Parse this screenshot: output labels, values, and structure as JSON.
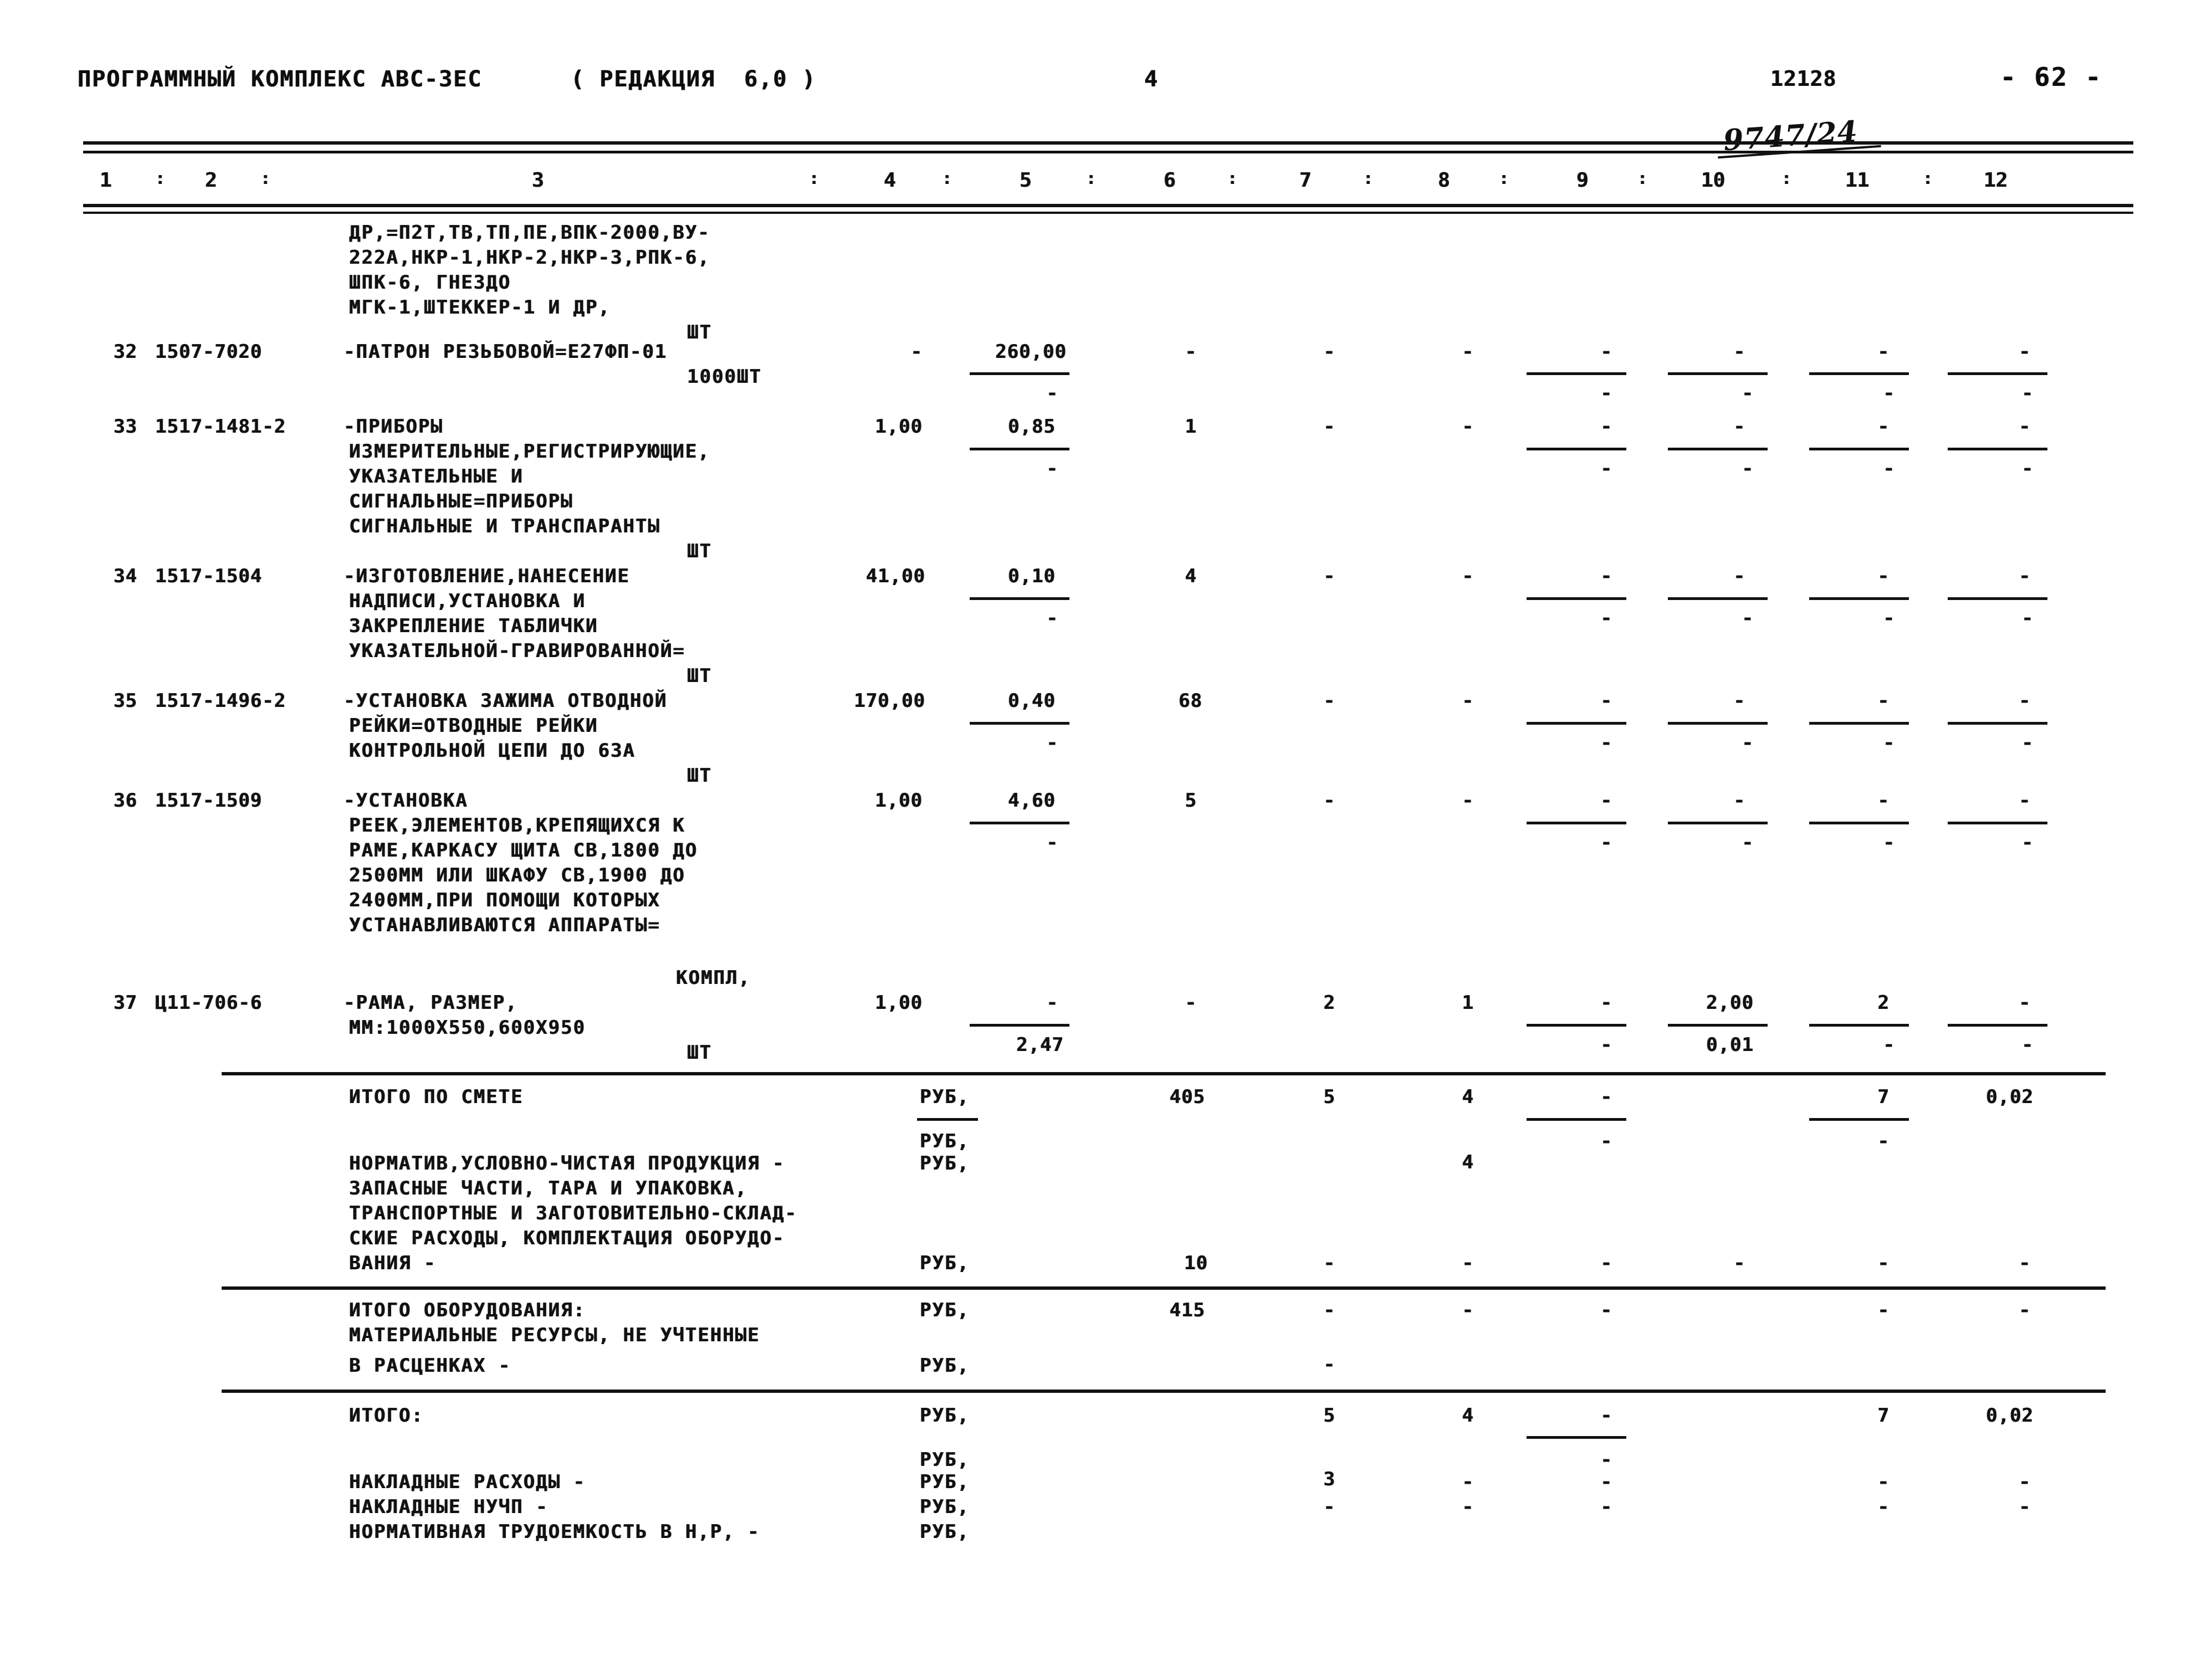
{
  "header": {
    "title": "ПРОГРАММНЫЙ КОМПЛЕКС АВС-3ЕС",
    "edition": "( РЕДАКЦИЯ  6,0 )",
    "sheet_marker": "4",
    "doc_number": "12128",
    "page_label": "- 62 -",
    "handwritten_note": "9747/24"
  },
  "table": {
    "column_headers": [
      "1",
      "2",
      "3",
      "4",
      "5",
      "6",
      "7",
      "8",
      "9",
      "10",
      "11",
      "12"
    ],
    "column_separator": ":",
    "continuation_block": {
      "description_lines": [
        "ДР,=П2Т,ТВ,ТП,ПЕ,ВПК-2000,ВУ-",
        "222А,НКР-1,НКР-2,НКР-3,РПК-6,",
        "ШПК-6, ГНЕЗДО",
        "МГК-1,ШТЕККЕР-1 И ДР,"
      ],
      "unit": "ШТ"
    },
    "rows": [
      {
        "num": "32",
        "code": "1507-7020",
        "description_lines": [
          "-ПАТРОН РЕЗЬБОВОЙ=Е27ФП-01"
        ],
        "unit_below": "1000ШТ",
        "c4": "-",
        "c5": "260,00",
        "c5b": "-",
        "c6": "-",
        "c7": "-",
        "c8": "-",
        "c9": "-",
        "c9b": "-",
        "c10": "-",
        "c10b": "-",
        "c11": "-",
        "c11b": "-",
        "c12": "-",
        "c12b": "-"
      },
      {
        "num": "33",
        "code": "1517-1481-2",
        "description_lines": [
          "-ПРИБОРЫ",
          "ИЗМЕРИТЕЛЬНЫЕ,РЕГИСТРИРУЮЩИЕ,",
          "УКАЗАТЕЛЬНЫЕ И",
          "СИГНАЛЬНЫЕ=ПРИБОРЫ",
          "СИГНАЛЬНЫЕ И ТРАНСПАРАНТЫ"
        ],
        "unit_below": "ШТ",
        "c4": "1,00",
        "c5": "0,85",
        "c5b": "-",
        "c6": "1",
        "c7": "-",
        "c8": "-",
        "c9": "-",
        "c9b": "-",
        "c10": "-",
        "c10b": "-",
        "c11": "-",
        "c11b": "-",
        "c12": "-",
        "c12b": "-"
      },
      {
        "num": "34",
        "code": "1517-1504",
        "description_lines": [
          "-ИЗГОТОВЛЕНИЕ,НАНЕСЕНИЕ",
          "НАДПИСИ,УСТАНОВКА И",
          "ЗАКРЕПЛЕНИЕ ТАБЛИЧКИ",
          "УКАЗАТЕЛЬНОЙ-ГРАВИРОВАННОЙ="
        ],
        "unit_below": "ШТ",
        "c4": "41,00",
        "c5": "0,10",
        "c5b": "-",
        "c6": "4",
        "c7": "-",
        "c8": "-",
        "c9": "-",
        "c9b": "-",
        "c10": "-",
        "c10b": "-",
        "c11": "-",
        "c11b": "-",
        "c12": "-",
        "c12b": "-"
      },
      {
        "num": "35",
        "code": "1517-1496-2",
        "description_lines": [
          "-УСТАНОВКА ЗАЖИМА ОТВОДНОЙ",
          "РЕЙКИ=ОТВОДНЫЕ РЕЙКИ",
          "КОНТРОЛЬНОЙ ЦЕПИ ДО 63А"
        ],
        "unit_below": "ШТ",
        "c4": "170,00",
        "c5": "0,40",
        "c5b": "-",
        "c6": "68",
        "c7": "-",
        "c8": "-",
        "c9": "-",
        "c9b": "-",
        "c10": "-",
        "c10b": "-",
        "c11": "-",
        "c11b": "-",
        "c12": "-",
        "c12b": "-"
      },
      {
        "num": "36",
        "code": "1517-1509",
        "description_lines": [
          "-УСТАНОВКА",
          "РЕЕК,ЭЛЕМЕНТОВ,КРЕПЯЩИХСЯ К",
          "РАМЕ,КАРКАСУ ЩИТА СВ,1800 ДО",
          "2500ММ ИЛИ ШКАФУ СВ,1900 ДО",
          "2400ММ,ПРИ ПОМОЩИ КОТОРЫХ",
          "УСТАНАВЛИВАЮТСЯ АППАРАТЫ="
        ],
        "unit_below": "КОМПЛ,",
        "c4": "1,00",
        "c5": "4,60",
        "c5b": "-",
        "c6": "5",
        "c7": "-",
        "c8": "-",
        "c9": "-",
        "c9b": "-",
        "c10": "-",
        "c10b": "-",
        "c11": "-",
        "c11b": "-",
        "c12": "-",
        "c12b": "-"
      },
      {
        "num": "37",
        "code": "Ц11-706-6",
        "description_lines": [
          "-РАМА, РАЗМЕР,",
          "ММ:1000Х550,600Х950"
        ],
        "unit_below": "ШТ",
        "c4": "1,00",
        "c5": "-",
        "c5b": "2,47",
        "c6": "-",
        "c7": "2",
        "c8": "1",
        "c9": "-",
        "c9b": "-",
        "c10": "2,00",
        "c10b": "0,01",
        "c11": "2",
        "c11b": "-",
        "c12": "-",
        "c12b": "-"
      }
    ],
    "summary": [
      {
        "key": "itogo-po-smete",
        "label_lines": [
          "ИТОГО ПО СМЕТЕ"
        ],
        "unit_lines": [
          "РУБ,"
        ],
        "values": {
          "c6": "405",
          "c7": "5",
          "c8": "4",
          "c9": "-",
          "c11": "7",
          "c12": "0,02"
        }
      },
      {
        "key": "normativ-uchp",
        "label_lines": [
          "НОРМАТИВ,УСЛОВНО-ЧИСТАЯ ПРОДУКЦИЯ -",
          "ЗАПАСНЫЕ ЧАСТИ, ТАРА И УПАКОВКА,",
          "ТРАНСПОРТНЫЕ И ЗАГОТОВИТЕЛЬНО-СКЛАД-",
          "СКИЕ РАСХОДЫ, КОМПЛЕКТАЦИЯ ОБОРУДО-",
          "ВАНИЯ -"
        ],
        "unit_lines": [
          "РУБ,",
          "РУБ,",
          "РУБ,"
        ],
        "values": {
          "c8": "4",
          "c9": "-",
          "c11": "-",
          "c6b": "10",
          "c7b": "-",
          "c8b": "-",
          "c9b": "-",
          "c10b": "-",
          "c11b": "-",
          "c12b": "-"
        }
      },
      {
        "key": "itogo-oborudovaniya",
        "label_lines": [
          "ИТОГО ОБОРУДОВАНИЯ:",
          "МАТЕРИАЛЬНЫЕ РЕСУРСЫ, НЕ УЧТЕННЫЕ",
          "В РАСЦЕНКАХ -"
        ],
        "unit_lines": [
          "РУБ,",
          "РУБ,"
        ],
        "values": {
          "c6": "415",
          "c7": "-",
          "c8": "-",
          "c9": "-",
          "c11": "-",
          "c12": "-",
          "c7b": "-"
        }
      },
      {
        "key": "itogo",
        "label_lines": [
          "ИТОГО:"
        ],
        "unit_lines": [
          "РУБ,"
        ],
        "values": {
          "c7": "5",
          "c8": "4",
          "c9": "-",
          "c11": "7",
          "c12": "0,02"
        }
      },
      {
        "key": "nakladnye",
        "label_lines": [
          "НАКЛАДНЫЕ РАСХОДЫ -",
          "НАКЛАДНЫЕ НУЧП -",
          "НОРМАТИВНАЯ ТРУДОЕМКОСТЬ В Н,Р, -"
        ],
        "unit_lines": [
          "РУБ,",
          "РУБ,",
          "РУБ,",
          "РУБ,"
        ],
        "values": {
          "c9": "-",
          "c7": "3",
          "c8": "-",
          "c9b": "-",
          "c11": "-",
          "c12": "-",
          "c7c": "-",
          "c8c": "-",
          "c9c": "-",
          "c11c": "-",
          "c12c": "-"
        }
      }
    ]
  }
}
